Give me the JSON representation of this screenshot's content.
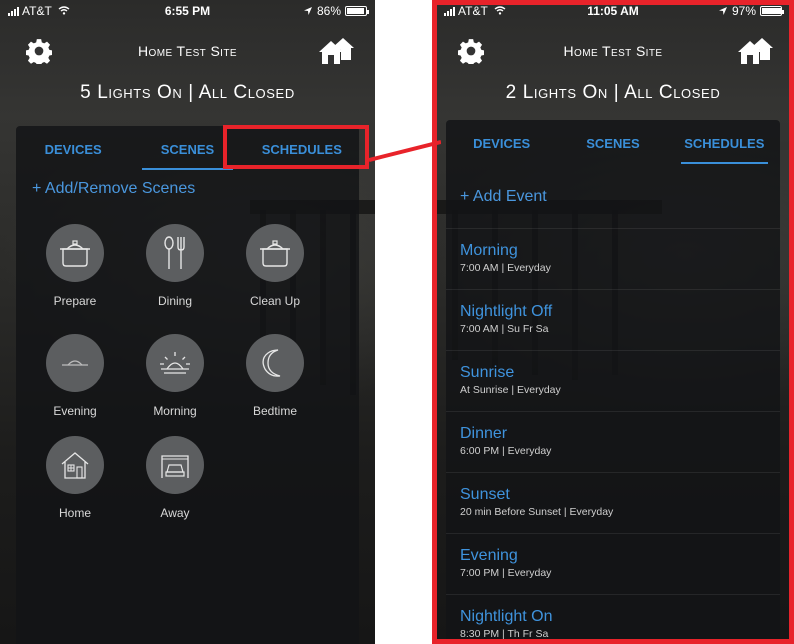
{
  "left_screen": {
    "status": {
      "carrier": "AT&T",
      "time": "6:55 PM",
      "battery": "86%",
      "battery_level": 0.86
    },
    "site_title": "Home Test Site",
    "summary": "5 Lights On | All Closed",
    "tabs": [
      {
        "label": "DEVICES",
        "active": false
      },
      {
        "label": "SCENES",
        "active": true
      },
      {
        "label": "SCHEDULES",
        "active": false
      }
    ],
    "add_link": "+ Add/Remove Scenes",
    "scenes": [
      {
        "label": "Prepare",
        "icon": "cooking-pot-icon"
      },
      {
        "label": "Dining",
        "icon": "fork-spoon-icon"
      },
      {
        "label": "Clean Up",
        "icon": "cooking-pot-icon"
      },
      {
        "label": "Evening",
        "icon": "sunset-icon"
      },
      {
        "label": "Morning",
        "icon": "sunrise-icon"
      },
      {
        "label": "Bedtime",
        "icon": "moon-icon"
      },
      {
        "label": "Home",
        "icon": "house-icon"
      },
      {
        "label": "Away",
        "icon": "garage-car-icon"
      }
    ]
  },
  "right_screen": {
    "status": {
      "carrier": "AT&T",
      "time": "11:05 AM",
      "battery": "97%",
      "battery_level": 0.97
    },
    "site_title": "Home Test Site",
    "summary": "2 Lights On | All Closed",
    "tabs": [
      {
        "label": "DEVICES",
        "active": false
      },
      {
        "label": "SCENES",
        "active": false
      },
      {
        "label": "SCHEDULES",
        "active": true
      }
    ],
    "add_link": "+ Add Event",
    "events": [
      {
        "name": "Morning",
        "meta": "7:00 AM | Everyday"
      },
      {
        "name": "Nightlight Off",
        "meta": "7:00 AM | Su Fr Sa"
      },
      {
        "name": "Sunrise",
        "meta": "At Sunrise | Everyday"
      },
      {
        "name": "Dinner",
        "meta": "6:00 PM | Everyday"
      },
      {
        "name": "Sunset",
        "meta": "20 min Before Sunset | Everyday"
      },
      {
        "name": "Evening",
        "meta": "7:00 PM | Everyday"
      },
      {
        "name": "Nightlight On",
        "meta": "8:30 PM | Th Fr Sa"
      }
    ]
  },
  "colors": {
    "accent": "#3a8fd9",
    "callout": "#e8232a",
    "icon_circle": "#5c5e60"
  },
  "icons": {
    "settings": "gear-icon",
    "home_switch": "houses-icon",
    "location": "location-arrow-icon",
    "wifi": "wifi-icon"
  }
}
